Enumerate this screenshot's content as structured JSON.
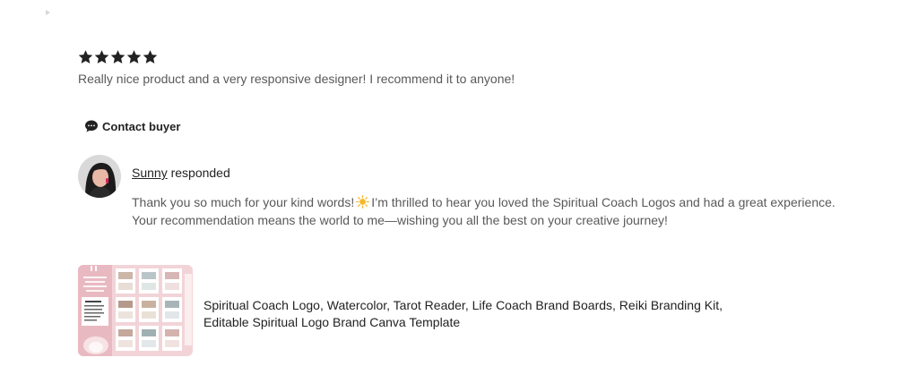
{
  "review": {
    "rating": 5,
    "rating_max": 5,
    "text": "Really nice product and a very responsive designer! I recommend it to anyone!"
  },
  "contact": {
    "label": "Contact buyer",
    "icon": "chat-bubble-icon"
  },
  "response": {
    "responder_name": "Sunny",
    "responded_label": " responded",
    "line1_before_emoji": "Thank you so much for your kind words!",
    "emoji": "sun-emoji-icon",
    "line1_after_emoji": "I’m thrilled to hear you loved the Spiritual Coach Logos and had a great experience.",
    "line2": "Your recommendation means the world to me—wishing you all the best on your creative journey!"
  },
  "listing": {
    "title_line1": "Spiritual Coach Logo, Watercolor, Tarot Reader, Life Coach Brand Boards, Reiki Branding Kit,",
    "title_line2": "Editable Spiritual Logo Brand Canva Template"
  },
  "colors": {
    "star": "#222222",
    "muted_text": "#595959",
    "text": "#222222",
    "thumb_bg": "#f2d4d8",
    "sun": "#f5b82e"
  }
}
